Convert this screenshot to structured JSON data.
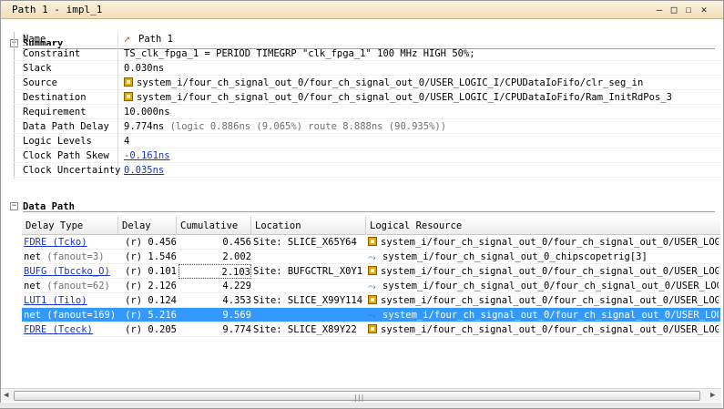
{
  "window": {
    "title": "Path 1 - impl_1",
    "controls": {
      "minimize": "—",
      "restore": "□",
      "maximize": "☐",
      "close": "✕"
    }
  },
  "summary": {
    "heading": "Summary",
    "rows": [
      {
        "label": "Name",
        "value": "Path 1",
        "icon": "path-icon"
      },
      {
        "label": "Constraint",
        "value": "TS_clk_fpga_1 = PERIOD TIMEGRP \"clk_fpga_1\" 100 MHz HIGH 50%;"
      },
      {
        "label": "Slack",
        "value": "0.030ns"
      },
      {
        "label": "Source",
        "value": "system_i/four_ch_signal_out_0/four_ch_signal_out_0/USER_LOGIC_I/CPUDataIoFifo/clr_seg_in",
        "icon": "chip-icon"
      },
      {
        "label": "Destination",
        "value": "system_i/four_ch_signal_out_0/four_ch_signal_out_0/USER_LOGIC_I/CPUDataIoFifo/Ram_InitRdPos_3",
        "icon": "chip-icon"
      },
      {
        "label": "Requirement",
        "value": "10.000ns"
      },
      {
        "label": "Data Path Delay",
        "value": "9.774ns",
        "detail": "(logic 0.886ns (9.065%)  route 8.888ns (90.935%))"
      },
      {
        "label": "Logic Levels",
        "value": "4"
      },
      {
        "label": "Clock Path Skew",
        "value": "-0.161ns",
        "link": true
      },
      {
        "label": "Clock Uncertainty",
        "value": "0.035ns",
        "link": true
      }
    ]
  },
  "data_path": {
    "heading": "Data Path",
    "columns": [
      "Delay Type",
      "Delay",
      "Cumulative",
      "Location",
      "Logical Resource"
    ],
    "rows": [
      {
        "type": "FDRE (Tcko)",
        "type_link": true,
        "fanout": "",
        "delay": "(r) 0.456",
        "cumulative": "0.456",
        "location": "Site: SLICE_X65Y64",
        "resource": "system_i/four_ch_signal_out_0/four_ch_signal_out_0/USER_LOGIC_I",
        "res_icon": "chip-icon"
      },
      {
        "type": "net",
        "type_link": false,
        "fanout": "(fanout=3)",
        "delay": "(r) 1.546",
        "cumulative": "2.002",
        "location": "",
        "resource": "system_i/four_ch_signal_out_0_chipscopetrig[3]",
        "res_icon": "net-icon"
      },
      {
        "type": "BUFG (Tbccko_O)",
        "type_link": true,
        "fanout": "",
        "delay": "(r) 0.101",
        "cumulative": "2.103",
        "location": "Site: BUFGCTRL_X0Y1",
        "resource": "system_i/four_ch_signal_out_0/four_ch_signal_out_0/USER_LOGIC_I",
        "res_icon": "chip-icon"
      },
      {
        "type": "net",
        "type_link": false,
        "fanout": "(fanout=62)",
        "delay": "(r) 2.126",
        "cumulative": "4.229",
        "location": "",
        "resource": "system_i/four_ch_signal_out_0/four_ch_signal_out_0/USER_LOGIC_I",
        "res_icon": "net-icon"
      },
      {
        "type": "LUT1 (Tilo)",
        "type_link": true,
        "fanout": "",
        "delay": "(r) 0.124",
        "cumulative": "4.353",
        "location": "Site: SLICE_X99Y114",
        "resource": "system_i/four_ch_signal_out_0/four_ch_signal_out_0/USER_LOGIC_I",
        "res_icon": "chip-icon"
      },
      {
        "type": "net",
        "type_link": false,
        "fanout": "(fanout=169)",
        "delay": "(r) 5.216",
        "cumulative": "9.569",
        "location": "",
        "resource": "system_i/four_ch_signal_out_0/four_ch_signal_out_0/USER_LOGIC_I",
        "res_icon": "net-icon",
        "selected": true
      },
      {
        "type": "FDRE (Tceck)",
        "type_link": true,
        "fanout": "",
        "delay": "(r) 0.205",
        "cumulative": "9.774",
        "location": "Site: SLICE_X89Y22",
        "resource": "system_i/four_ch_signal_out_0/four_ch_signal_out_0/USER_LOGIC_I",
        "res_icon": "chip-icon"
      }
    ]
  },
  "scrollbar": {
    "left_arrow": "◀",
    "right_arrow": "▶",
    "grip": "|||"
  },
  "colors": {
    "selection": "#3399ff",
    "link": "#1a33c8",
    "title_bar": "#f1dfb9"
  }
}
